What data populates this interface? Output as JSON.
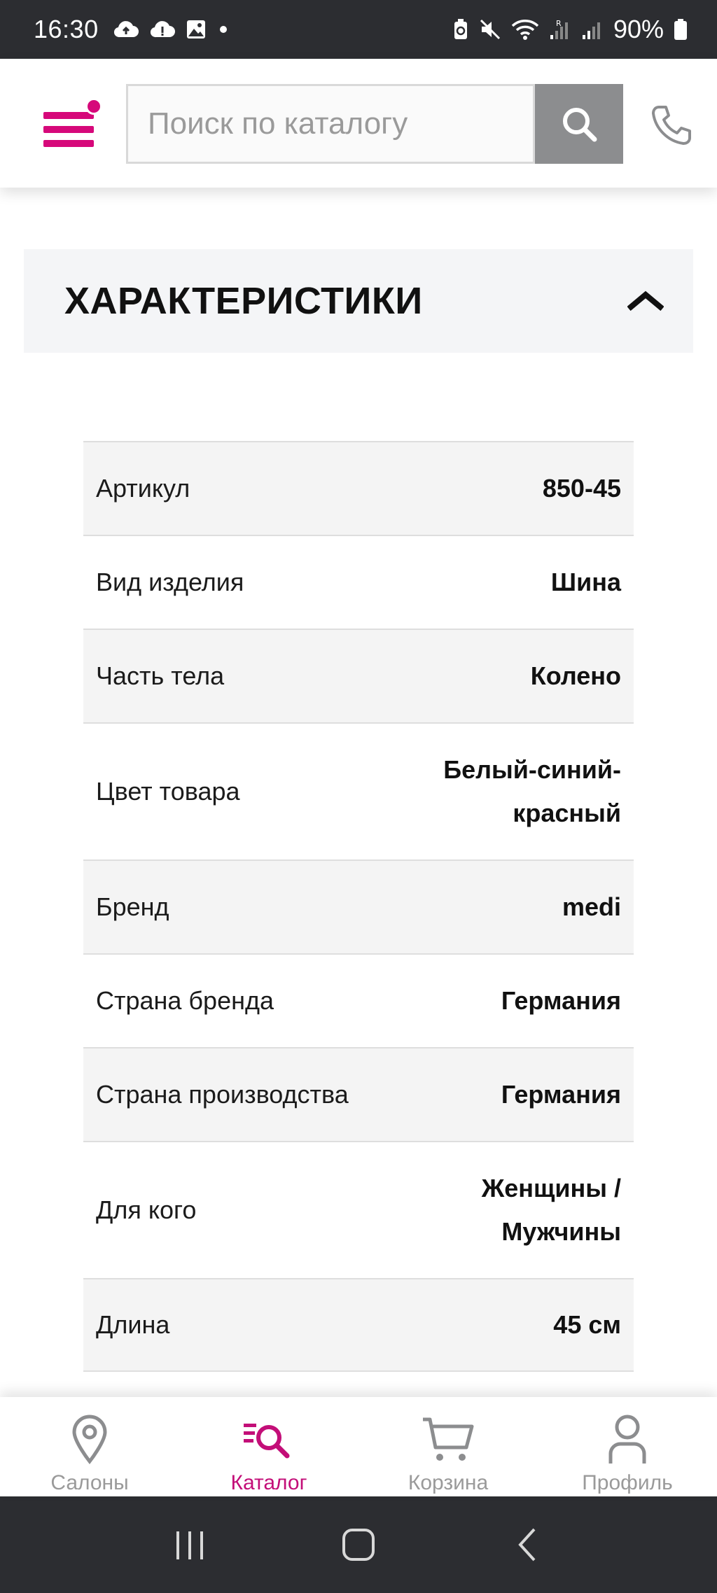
{
  "status_bar": {
    "time": "16:30",
    "battery": "90%",
    "left_icons": [
      "cloud-upload-icon",
      "cloud-alert-icon",
      "image-icon",
      "dot-icon"
    ],
    "right_icons": [
      "battery-saver-icon",
      "mute-icon",
      "wifi-icon",
      "signal-r-icon",
      "signal-icon",
      "battery-icon"
    ]
  },
  "header": {
    "search_placeholder": "Поиск по каталогу",
    "accent_color": "#d6087a"
  },
  "section": {
    "title": "ХАРАКТЕРИСТИКИ",
    "expanded": true
  },
  "specs": [
    {
      "label": "Артикул",
      "value": "850-45"
    },
    {
      "label": "Вид изделия",
      "value": "Шина"
    },
    {
      "label": "Часть тела",
      "value": "Колено"
    },
    {
      "label": "Цвет товара",
      "value": "Белый-синий-красный"
    },
    {
      "label": "Бренд",
      "value": "medi"
    },
    {
      "label": "Страна бренда",
      "value": "Германия"
    },
    {
      "label": "Страна производства",
      "value": "Германия"
    },
    {
      "label": "Для кого",
      "value": "Женщины / Мужчины"
    },
    {
      "label": "Длина",
      "value": "45 см"
    }
  ],
  "bottom_nav": {
    "items": [
      {
        "label": "Салоны",
        "icon": "map-pin-icon",
        "active": false
      },
      {
        "label": "Каталог",
        "icon": "catalog-search-icon",
        "active": true
      },
      {
        "label": "Корзина",
        "icon": "cart-icon",
        "active": false
      },
      {
        "label": "Профиль",
        "icon": "user-icon",
        "active": false
      }
    ]
  },
  "system_nav": {
    "buttons": [
      "recents-icon",
      "home-icon",
      "back-icon"
    ]
  }
}
